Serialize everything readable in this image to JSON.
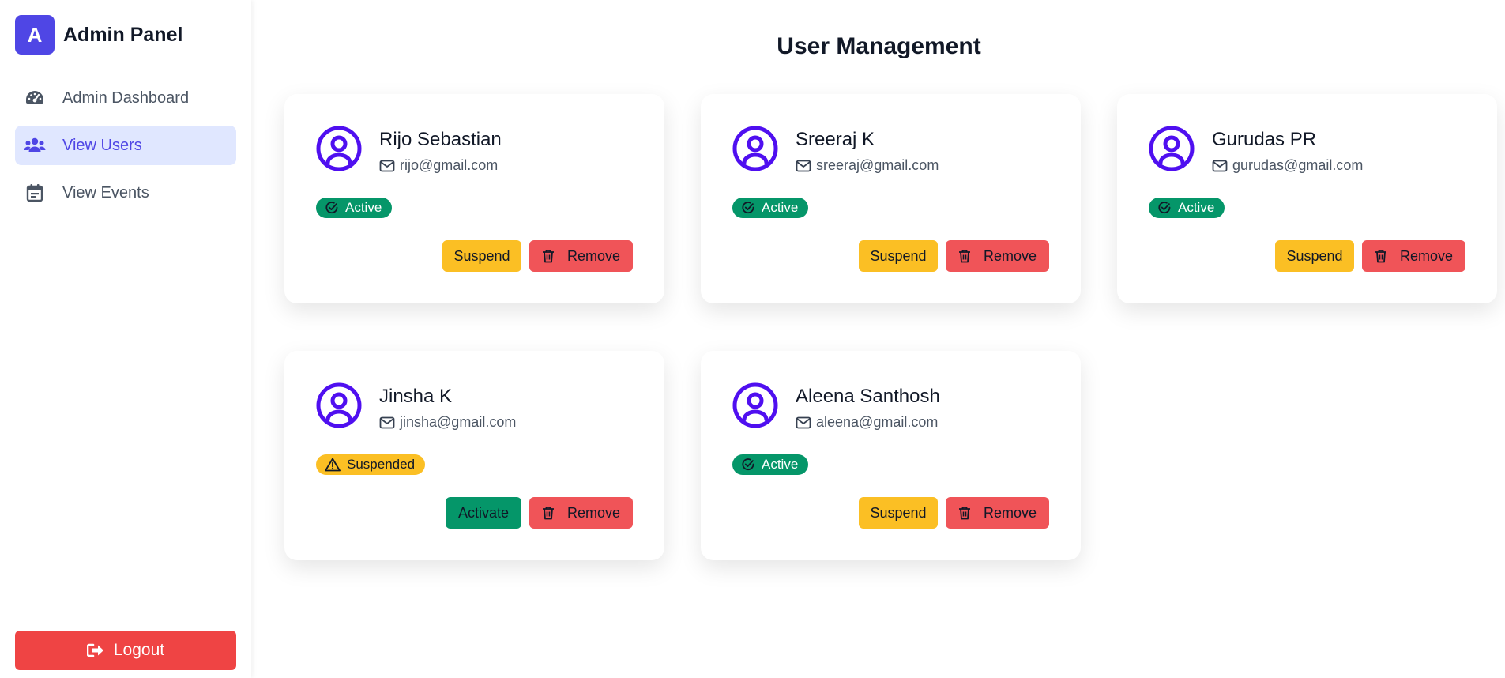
{
  "brand": {
    "logo_letter": "A",
    "title": "Admin Panel"
  },
  "nav": {
    "items": [
      {
        "label": "Admin Dashboard",
        "icon": "gauge-icon",
        "active": false
      },
      {
        "label": "View Users",
        "icon": "users-icon",
        "active": true
      },
      {
        "label": "View Events",
        "icon": "calendar-icon",
        "active": false
      }
    ],
    "logout_label": "Logout"
  },
  "main": {
    "title": "User Management",
    "users": [
      {
        "name": "Rijo Sebastian",
        "email": "rijo@gmail.com",
        "status": "Active",
        "primary_action": "Suspend",
        "remove_label": "Remove"
      },
      {
        "name": "Sreeraj K",
        "email": "sreeraj@gmail.com",
        "status": "Active",
        "primary_action": "Suspend",
        "remove_label": "Remove"
      },
      {
        "name": "Gurudas PR",
        "email": "gurudas@gmail.com",
        "status": "Active",
        "primary_action": "Suspend",
        "remove_label": "Remove"
      },
      {
        "name": "Jinsha K",
        "email": "jinsha@gmail.com",
        "status": "Suspended",
        "primary_action": "Activate",
        "remove_label": "Remove"
      },
      {
        "name": "Aleena Santhosh",
        "email": "aleena@gmail.com",
        "status": "Active",
        "primary_action": "Suspend",
        "remove_label": "Remove"
      }
    ]
  },
  "colors": {
    "accent": "#4f46e5",
    "avatar": "#4f0ff0",
    "active_badge": "#059669",
    "suspended_badge": "#fbbf24",
    "remove_button": "#f05458",
    "logout_button": "#ef4444"
  }
}
